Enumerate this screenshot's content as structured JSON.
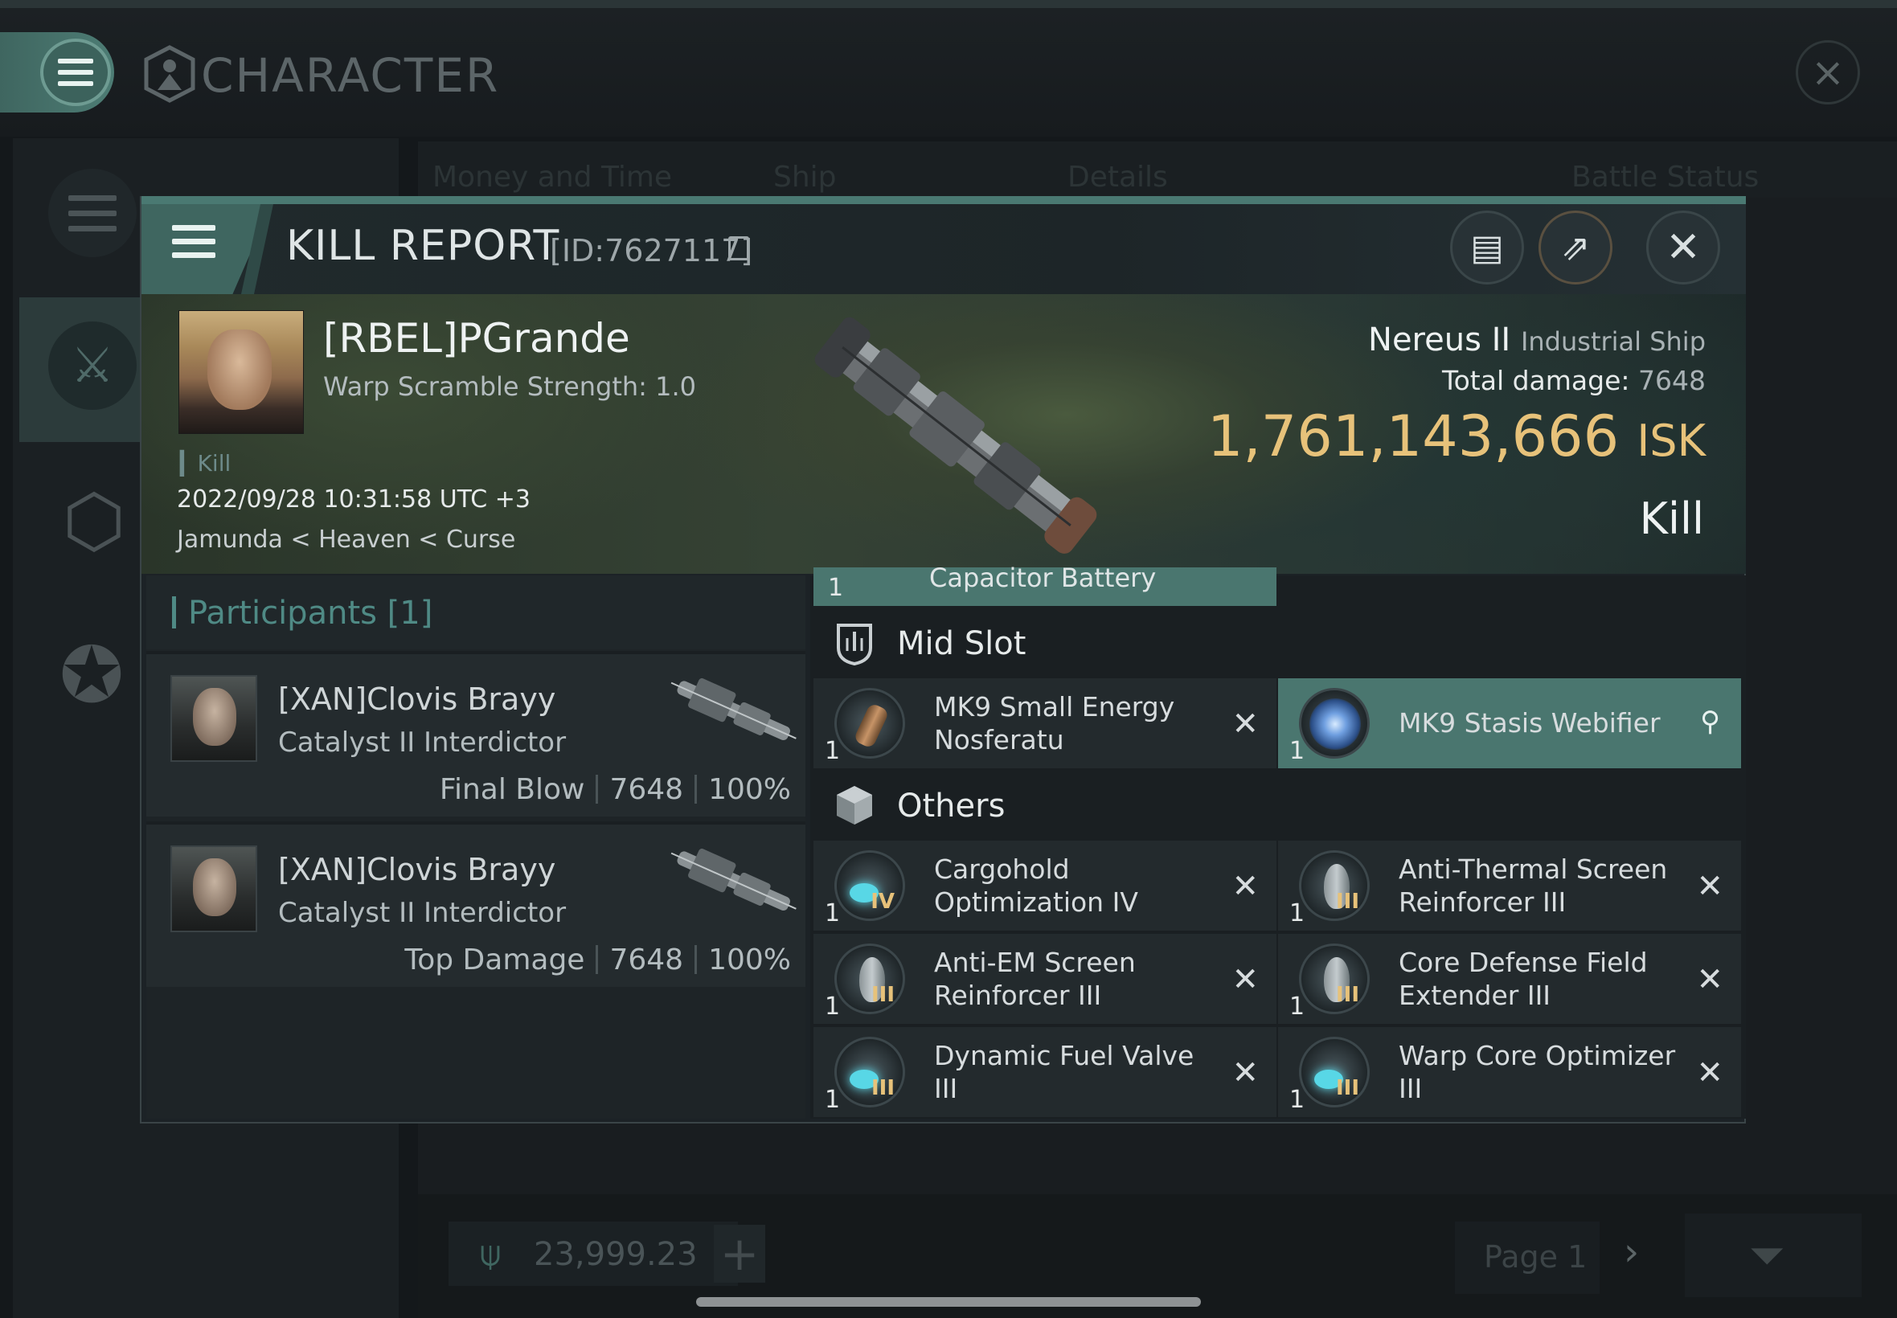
{
  "background": {
    "title": "CHARACTER",
    "tabs": [
      "Money and Time",
      "Ship",
      "Details",
      "Battle Status"
    ],
    "isk_balance": "23,999.23",
    "page": "Page 1"
  },
  "report": {
    "title": "KILL REPORT",
    "id": "[ID:7627117]",
    "victim": {
      "name": "[RBEL]PGrande",
      "warp_scramble": "Warp Scramble Strength: 1.0",
      "tag": "Kill",
      "datetime": "2022/09/28 10:31:58 UTC +3",
      "location": "Jamunda < Heaven < Curse"
    },
    "ship": {
      "name": "Nereus II",
      "class": "Industrial Ship",
      "total_damage_label": "Total damage:",
      "total_damage": "7648",
      "isk_value": "1,761,143,666",
      "isk_unit": "ISK",
      "result": "Kill"
    },
    "participants": {
      "label": "Participants [1]",
      "list": [
        {
          "name": "[XAN]Clovis Brayy",
          "ship": "Catalyst II Interdictor",
          "role": "Final Blow",
          "damage": "7648",
          "percent": "100%"
        },
        {
          "name": "[XAN]Clovis Brayy",
          "ship": "Catalyst II Interdictor",
          "role": "Top Damage",
          "damage": "7648",
          "percent": "100%"
        }
      ]
    },
    "slots": {
      "partial_item": {
        "qty": "1",
        "name": "Capacitor Battery"
      },
      "mid_slot_label": "Mid Slot",
      "mid_items": [
        {
          "qty": "1",
          "name": "MK9 Small Energy Nosferatu",
          "status": "destroyed"
        },
        {
          "qty": "1",
          "name": "MK9 Stasis Webifier",
          "status": "dropped"
        }
      ],
      "others_label": "Others",
      "other_items": [
        {
          "qty": "1",
          "name": "Cargohold Optimization IV",
          "meta": "IV"
        },
        {
          "qty": "1",
          "name": "Anti-Thermal Screen Reinforcer III",
          "meta": "III"
        },
        {
          "qty": "1",
          "name": "Anti-EM Screen Reinforcer III",
          "meta": "III"
        },
        {
          "qty": "1",
          "name": "Core Defense Field Extender III",
          "meta": "III"
        },
        {
          "qty": "1",
          "name": "Dynamic Fuel Valve III",
          "meta": "III"
        },
        {
          "qty": "1",
          "name": "Warp Core Optimizer III",
          "meta": "III"
        }
      ]
    }
  },
  "colors": {
    "accent": "#4a766f",
    "isk_gold": "#e7c27a",
    "participants_teal": "#4f8a85"
  },
  "icons": {
    "menu": "hamburger-icon",
    "clipboard": "clipboard-icon",
    "share": "share-icon",
    "close": "close-icon",
    "mid_slot": "mid-slot-icon",
    "others": "cube-icon",
    "destroyed": "x-icon",
    "dropped": "pilot-icon"
  }
}
